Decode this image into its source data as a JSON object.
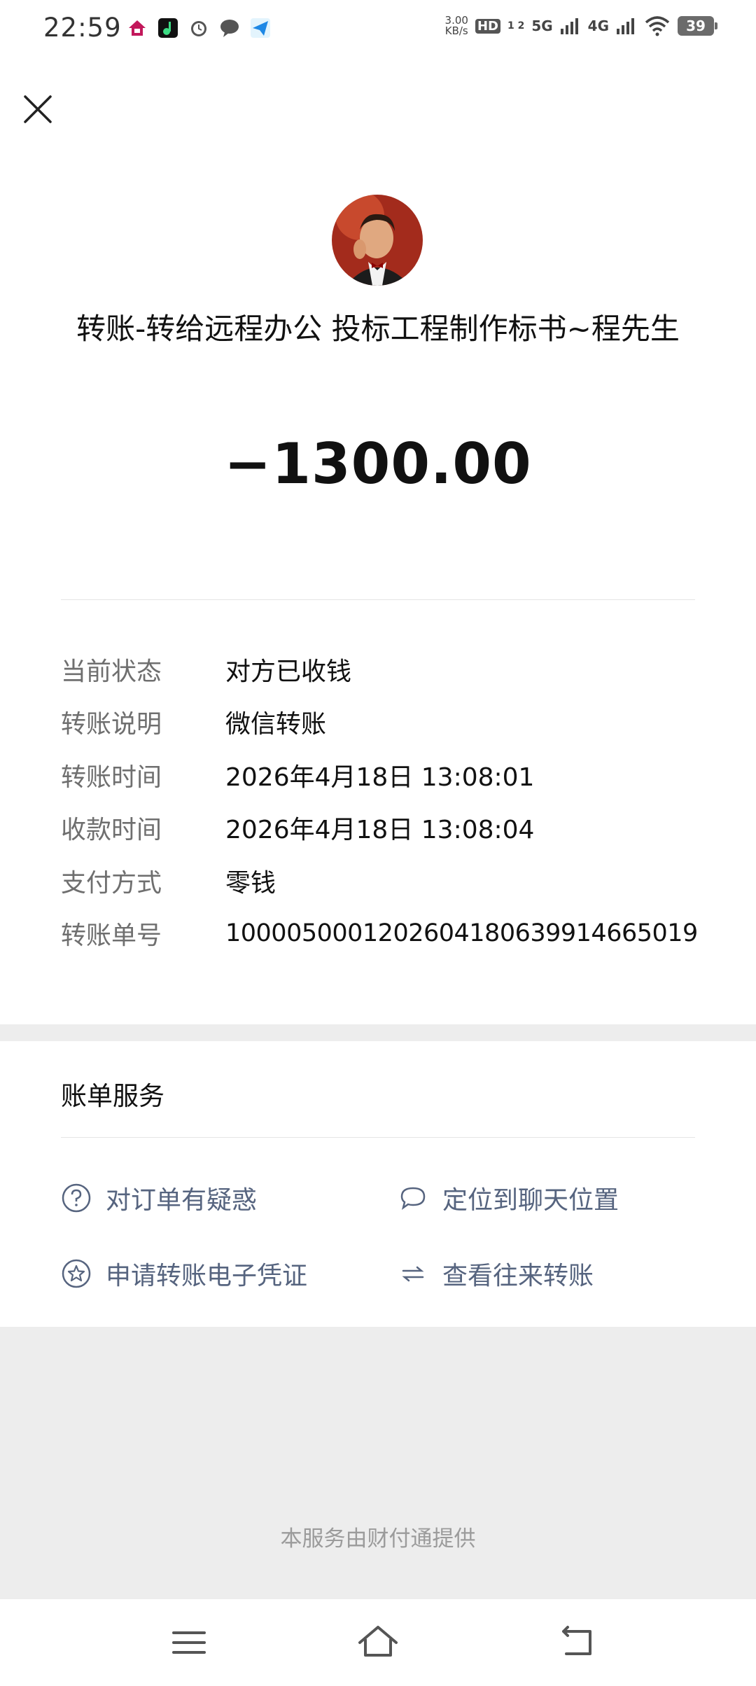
{
  "status_bar": {
    "time": "22:59",
    "net_speed_value": "3.00",
    "net_speed_unit": "KB/s",
    "hd": "HD",
    "hd_sub": "1 2",
    "sig1": "5G",
    "sig2": "4G",
    "battery": "39"
  },
  "transfer": {
    "title": "转账-转给远程办公 投标工程制作标书~程先生",
    "amount": "−1300.00"
  },
  "details": [
    {
      "label": "当前状态",
      "value": "对方已收钱"
    },
    {
      "label": "转账说明",
      "value": "微信转账"
    },
    {
      "label": "转账时间",
      "value": "2026年4月18日 13:08:01"
    },
    {
      "label": "收款时间",
      "value": "2026年4月18日 13:08:04"
    },
    {
      "label": "支付方式",
      "value": "零钱"
    },
    {
      "label": "转账单号",
      "value": "100005000120260418063991466501​9"
    }
  ],
  "services": {
    "title": "账单服务",
    "items": [
      {
        "label": "对订单有疑惑",
        "icon": "question-circle-icon"
      },
      {
        "label": "定位到聊天位置",
        "icon": "chat-bubble-icon"
      },
      {
        "label": "申请转账电子凭证",
        "icon": "star-circle-icon"
      },
      {
        "label": "查看往来转账",
        "icon": "swap-arrows-icon"
      }
    ]
  },
  "footer": "本服务由财付通提供",
  "colors": {
    "link": "#56647f",
    "label": "#6f6f6f",
    "background": "#ededed"
  }
}
